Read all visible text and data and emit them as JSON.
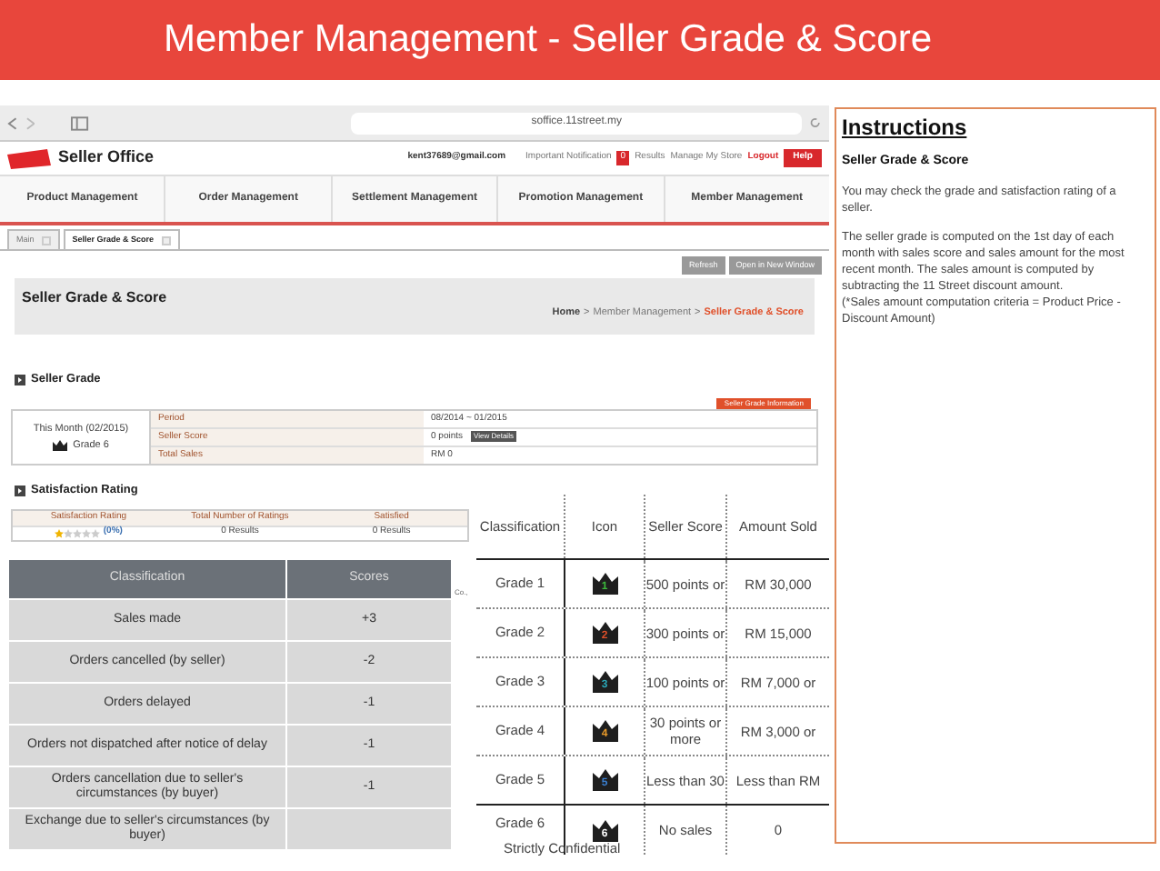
{
  "slide_title": "Member Management - Seller Grade & Score",
  "browser": {
    "url": "soffice.11street.my"
  },
  "app": {
    "logo": "Seller Office",
    "email": "kent37689@gmail.com",
    "links": [
      {
        "label": "Important Notification",
        "badge": "0"
      },
      {
        "label": "Results"
      },
      {
        "label": "Manage My Store"
      },
      {
        "label": "Logout",
        "kind": "logout"
      },
      {
        "label": "Help",
        "kind": "help"
      }
    ]
  },
  "nav": [
    "Product Management",
    "Order Management",
    "Settlement Management",
    "Promotion Management",
    "Member Management"
  ],
  "tabs": [
    {
      "label": "Main",
      "selected": false
    },
    {
      "label": "Seller Grade & Score",
      "selected": true
    }
  ],
  "toolbar_buttons": [
    "Refresh",
    "Open in New Window"
  ],
  "page_title": "Seller Grade & Score",
  "breadcrumb": [
    "Home",
    "Member Management",
    "Seller Grade & Score"
  ],
  "breadcrumb_separator": ">",
  "seller_grade": {
    "heading": "Seller Grade",
    "month": "This Month (02/2015)",
    "grade": "Grade 6",
    "rows": [
      {
        "label": "Period",
        "value": "08/2014 ~ 01/2015"
      },
      {
        "label": "Seller Score",
        "value": "0 points",
        "button": "View Details"
      },
      {
        "label": "Total Sales",
        "value": "RM 0"
      }
    ],
    "info_button": "Seller Grade Information"
  },
  "satisfaction": {
    "heading": "Satisfaction Rating",
    "columns": [
      "Satisfaction Rating",
      "Total Number of Ratings",
      "Satisfied"
    ],
    "stars": 1,
    "percent": "(0%)",
    "cells": [
      "0 Results",
      "0 Results"
    ]
  },
  "hidden_fragment": "Co.,",
  "score_table": {
    "columns": [
      "Classification",
      "Scores"
    ],
    "rows": [
      [
        "Sales made",
        "+3"
      ],
      [
        "Orders cancelled (by seller)",
        "-2"
      ],
      [
        "Orders delayed",
        "-1"
      ],
      [
        "Orders not dispatched after notice of delay",
        "-1"
      ],
      [
        "Orders cancellation due to seller's circumstances (by buyer)",
        "-1"
      ],
      [
        "Exchange due to seller's circumstances (by buyer)",
        ""
      ]
    ]
  },
  "grade_table": {
    "columns": [
      "Classification",
      "Icon",
      "Seller Score",
      "Amount Sold"
    ],
    "rows": [
      {
        "grade": "Grade 1",
        "badge": "1",
        "color": "#3cb93c",
        "score": "500 points or",
        "amount": "RM 30,000"
      },
      {
        "grade": "Grade 2",
        "badge": "2",
        "color": "#e0502a",
        "score": "300 points or",
        "amount": "RM 15,000"
      },
      {
        "grade": "Grade 3",
        "badge": "3",
        "color": "#2aa8b8",
        "score": "100 points or",
        "amount": "RM 7,000 or"
      },
      {
        "grade": "Grade 4",
        "badge": "4",
        "color": "#e89a2a",
        "score": "30 points or more",
        "amount": "RM 3,000 or"
      },
      {
        "grade": "Grade 5",
        "badge": "5",
        "color": "#3a7fd0",
        "score": "Less than 30",
        "amount": "Less than RM"
      },
      {
        "grade": "Grade 6",
        "badge": "6",
        "color": "#ffffff",
        "score": "No sales",
        "amount": "0"
      }
    ]
  },
  "footer": "Strictly Confidential",
  "instructions": {
    "title": "Instructions",
    "subtitle": "Seller Grade & Score",
    "paragraphs": [
      "You may check the grade and satisfaction rating of a seller.",
      "The seller grade is computed on the 1st day of each month with sales score and sales amount for the most recent month. The sales amount is computed by subtracting the 11 Street discount amount.\n(*Sales amount computation criteria = Product Price - Discount Amount)"
    ]
  }
}
